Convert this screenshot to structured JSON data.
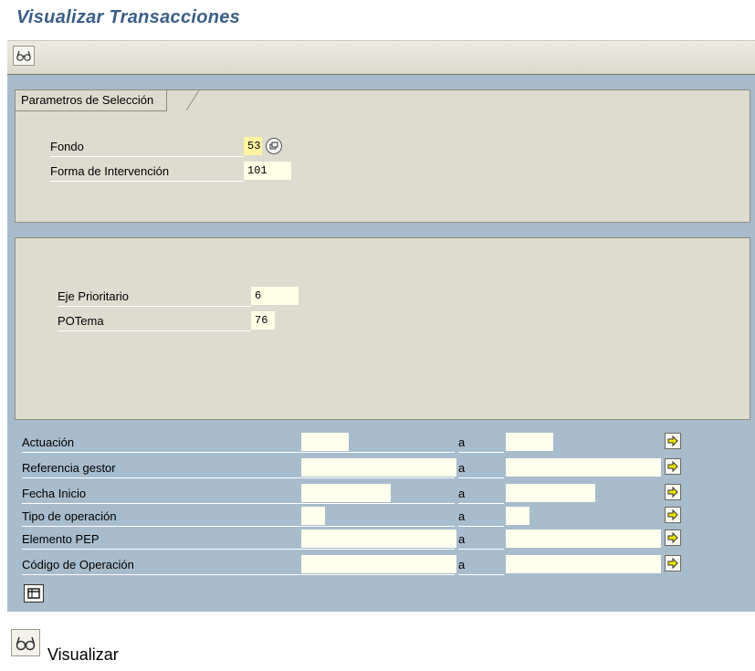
{
  "window": {
    "title": "Visualizar  Transacciones"
  },
  "toolbar": {
    "display_icon": "glasses-icon"
  },
  "group1": {
    "title": "Parametros de Selección",
    "fields": [
      {
        "label": "Fondo",
        "value": "53",
        "has_help": true
      },
      {
        "label": "Forma de Intervención",
        "value": "101"
      }
    ]
  },
  "group2": {
    "fields": [
      {
        "label": "Eje Prioritario",
        "value": "6"
      },
      {
        "label": "POTema",
        "value": "76"
      }
    ]
  },
  "selection": {
    "rows": [
      {
        "label": "Actuación",
        "to": "a"
      },
      {
        "label": "Referencia gestor",
        "to": "a"
      },
      {
        "label": "Fecha Inicio",
        "to": "a"
      },
      {
        "label": "Tipo de operación",
        "to": "a"
      },
      {
        "label": "Elemento PEP",
        "to": "a"
      },
      {
        "label": "Código de Operación",
        "to": "a"
      }
    ],
    "multi_select_icon": "arrow-right-icon",
    "bottom_icon": "variant-icon"
  },
  "legend": {
    "icon": "glasses-icon",
    "label": "Visualizar"
  },
  "colors": {
    "title": "#3a5f8a",
    "main_bg": "#a7bccd",
    "group_bg": "#dedccf",
    "required_field": "#fff5a3",
    "arrow_yellow": "#f2e600"
  }
}
